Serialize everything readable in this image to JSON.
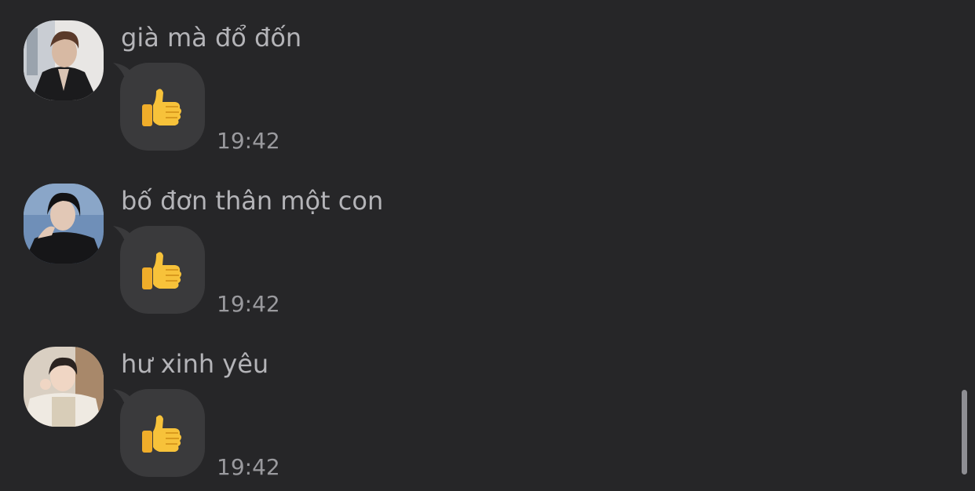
{
  "messages": [
    {
      "sender": "già mà đổ đốn",
      "reaction": "thumbs-up-emoji",
      "time": "19:42"
    },
    {
      "sender": "bố đơn thân một con",
      "reaction": "thumbs-up-emoji",
      "time": "19:42"
    },
    {
      "sender": "hư xinh yêu",
      "reaction": "thumbs-up-emoji",
      "time": "19:42"
    }
  ],
  "colors": {
    "background": "#262628",
    "bubble": "#3a3a3c",
    "sender_text": "#b4b4b8",
    "time_text": "#9a9a9e"
  }
}
